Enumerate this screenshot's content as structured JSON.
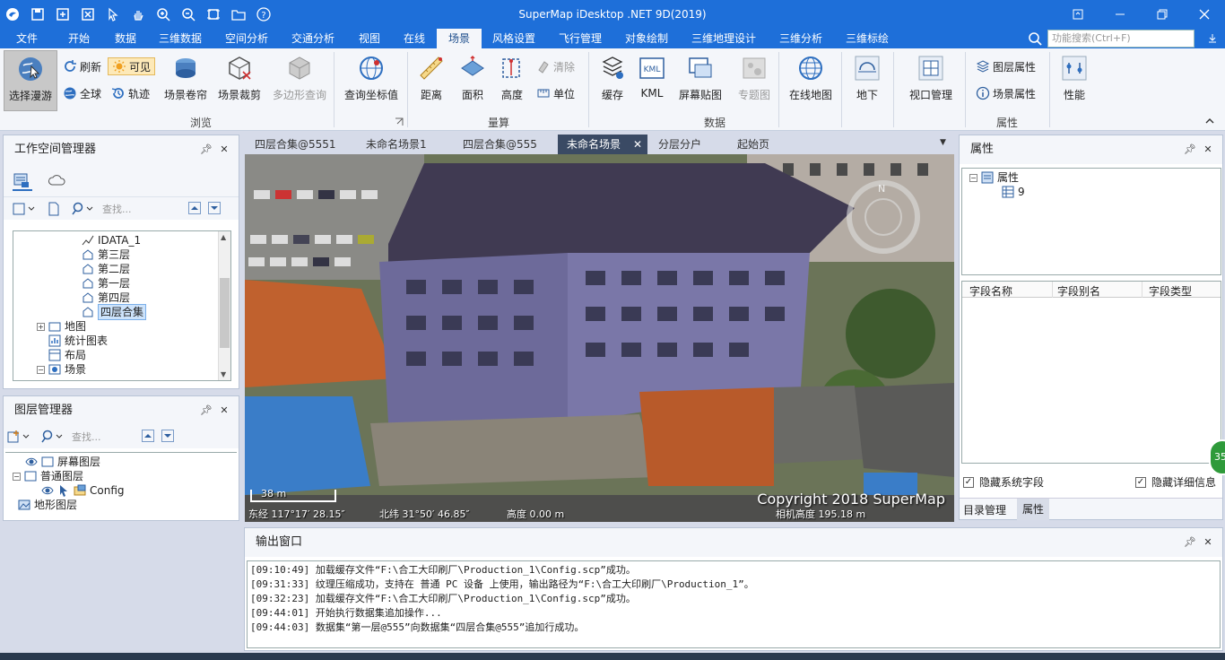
{
  "window": {
    "title": "SuperMap iDesktop .NET 9D(2019)"
  },
  "ribbon_tabs": [
    "文件",
    "开始",
    "数据",
    "三维数据",
    "空间分析",
    "交通分析",
    "视图",
    "在线",
    "场景",
    "风格设置",
    "飞行管理",
    "对象绘制",
    "三维地理设计",
    "三维分析",
    "三维标绘"
  ],
  "active_tab": "场景",
  "search": {
    "placeholder": "功能搜索(Ctrl+F)"
  },
  "ribbon": {
    "browse": {
      "label": "浏览",
      "select_roam": "选择漫游",
      "refresh": "刷新",
      "visible": "可见",
      "full_extent": "全球",
      "track": "轨迹",
      "scene_roll": "场景卷帘",
      "scene_clip": "场景裁剪",
      "polygon_query": "多边形查询",
      "query_coord": "查询坐标值"
    },
    "measure": {
      "label": "量算",
      "distance": "距离",
      "area": "面积",
      "height": "高度",
      "clear": "清除",
      "unit": "单位"
    },
    "data": {
      "label": "数据",
      "cache": "缓存",
      "kml": "KML",
      "screen_tile": "屏幕贴图",
      "thematic": "专题图",
      "online_map": "在线地图",
      "underground": "地下"
    },
    "viewport": {
      "label": "视口管理"
    },
    "attributes": {
      "label": "属性",
      "layer_props": "图层属性",
      "scene_props": "场景属性",
      "performance": "性能"
    }
  },
  "workspace_panel": {
    "title": "工作空间管理器",
    "search_placeholder": "查找...",
    "items": [
      "IDATA_1",
      "第三层",
      "第二层",
      "第一层",
      "第四层",
      "四层合集",
      "地图",
      "统计图表",
      "布局",
      "场景"
    ]
  },
  "layer_panel": {
    "title": "图层管理器",
    "search_placeholder": "查找...",
    "items": [
      "屏幕图层",
      "普通图层",
      "Config",
      "地形图层"
    ]
  },
  "doc_tabs": [
    "四层合集@5551",
    "未命名场景1",
    "四层合集@555",
    "未命名场景",
    "分层分户",
    "起始页"
  ],
  "active_doc_tab": "未命名场景",
  "scene": {
    "copyright": "Copyright 2018 SuperMap",
    "scale": "38 m",
    "lon": "东经 117°17′ 28.15″",
    "lat": "北纬 31°50′ 46.85″",
    "alt": "高度 0.00 m",
    "cam": "相机高度 195.18 m"
  },
  "props_panel": {
    "title": "属性",
    "tree_root": "属性",
    "tree_child": "9",
    "columns": [
      "字段名称",
      "字段别名",
      "字段类型"
    ],
    "hide_sys_fields": "隐藏系统字段",
    "hide_detail": "隐藏详细信息",
    "tab_catalog": "目录管理",
    "tab_props": "属性"
  },
  "output_panel": {
    "title": "输出窗口",
    "lines": [
      "[09:10:49] 加载缓存文件“F:\\合工大印刷厂\\Production_1\\Config.scp”成功。",
      "[09:31:33] 纹理压缩成功，支持在 普通 PC 设备 上使用，输出路径为“F:\\合工大印刷厂\\Production_1”。",
      "[09:32:23] 加载缓存文件“F:\\合工大印刷厂\\Production_1\\Config.scp”成功。",
      "[09:44:01] 开始执行数据集追加操作...",
      "[09:44:03] 数据集“第一层@555”向数据集“四层合集@555”追加行成功。"
    ]
  },
  "badge": "35",
  "colors": {
    "accent": "#1e6fd9",
    "panel_bg": "#f4f6fa",
    "active_doc": "#3a4a64"
  }
}
